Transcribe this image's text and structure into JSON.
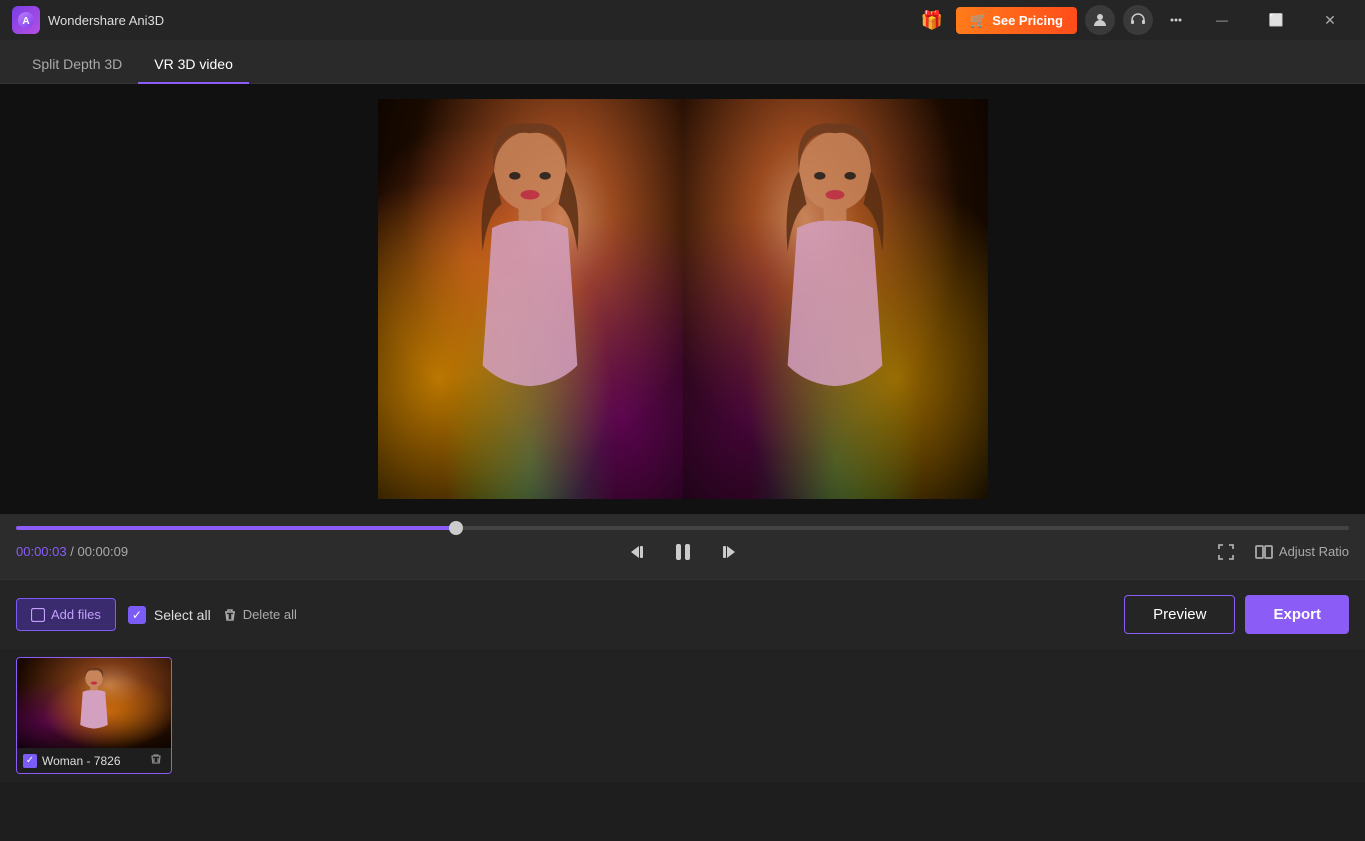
{
  "app": {
    "logo_emoji": "🎬",
    "title": "Wondershare Ani3D"
  },
  "title_bar": {
    "gift_emoji": "🎁",
    "see_pricing_label": "See Pricing",
    "cart_emoji": "🛒",
    "user_emoji": "👤",
    "headset_emoji": "🎧",
    "menu_emoji": "☰",
    "minimize_label": "—",
    "maximize_label": "⬜",
    "close_label": "✕"
  },
  "tabs": [
    {
      "id": "split-depth-3d",
      "label": "Split Depth 3D",
      "active": false
    },
    {
      "id": "vr-3d-video",
      "label": "VR 3D video",
      "active": true
    }
  ],
  "playback": {
    "current_time": "00:00:03",
    "total_time": "00:00:09",
    "progress_percent": 33,
    "adjust_ratio_label": "Adjust Ratio"
  },
  "toolbar": {
    "add_files_label": "Add files",
    "select_all_label": "Select all",
    "delete_all_label": "Delete all",
    "preview_label": "Preview",
    "export_label": "Export"
  },
  "files": [
    {
      "name": "Woman - 7826",
      "selected": true
    }
  ],
  "colors": {
    "accent": "#8b5cf6",
    "orange": "#ff7b1a",
    "bg_dark": "#1e1e1e",
    "bg_medium": "#252525"
  }
}
